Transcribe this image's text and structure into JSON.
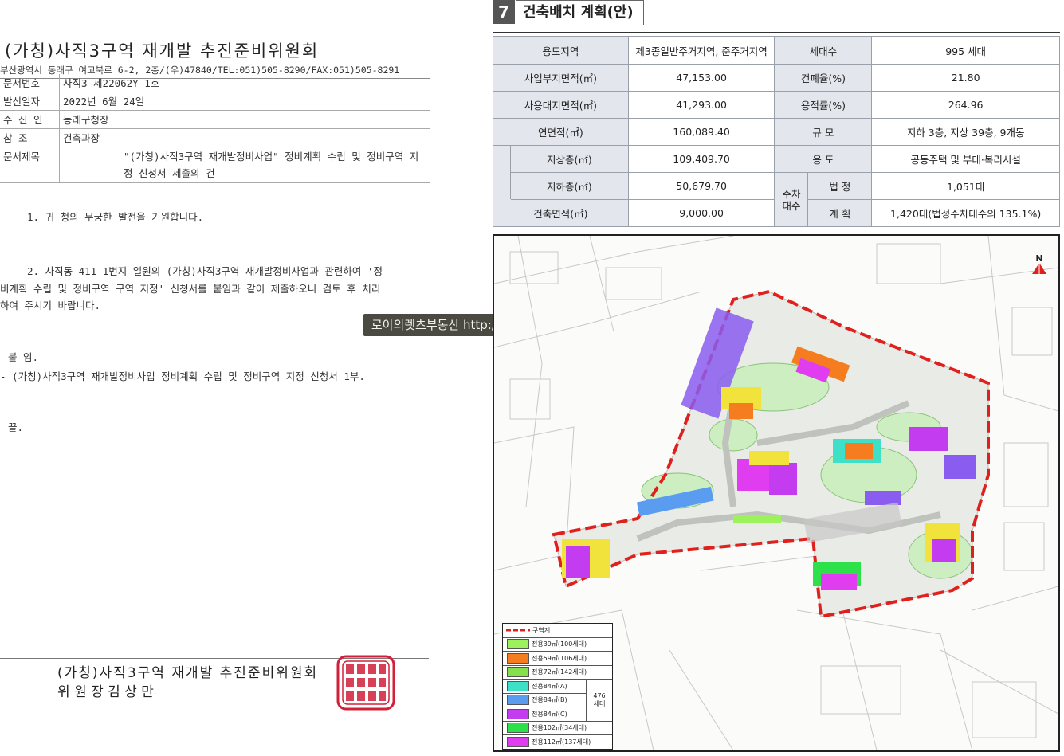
{
  "letter": {
    "org_title": "(가칭)사직3구역 재개발 추진준비위원회",
    "address": "부산광역시 동래구 여고북로 6-2, 2층/(우)47840/TEL:051)505-8290/FAX:051)505-8291",
    "meta": [
      {
        "label": "문서번호",
        "value": "사직3 제22062Y-1호"
      },
      {
        "label": "발신일자",
        "value": "2022년 6월 24일"
      },
      {
        "label": "수 신 인",
        "value": "동래구청장"
      },
      {
        "label": "참    조",
        "value": "건축과장"
      },
      {
        "label": "문서제목",
        "value": "\"(가칭)사직3구역 재개발정비사업\" 정비계획 수립 및 정비구역 지정 신청서 제출의 건"
      }
    ],
    "para1": "1. 귀 청의 무궁한 발전을 기원합니다.",
    "para2_line1": "2. 사직동 411-1번지 일원의 (가칭)사직3구역 재개발정비사업과 관련하여 '정",
    "para2_line2": "비계획 수립 및 정비구역 구역 지정' 신청서를 붙임과 같이 제출하오니 검토 후 처리",
    "para2_line3": "하여 주시기 바랍니다.",
    "attach_label": "붙 임.",
    "attach_item": "- (가칭)사직3구역 재개발정비사업 정비계획 수립 및 정비구역 지정 신청서 1부.",
    "end_mark": "끝.",
    "sign_org": "(가칭)사직3구역 재개발 추진준비위원회",
    "sign_name": "위   원   장   김   상   만",
    "seal_text": "사직3구역재개발추진준비위원회"
  },
  "watermark": "로이의렛츠부동산 http://letsbudongsan.com",
  "section": {
    "number": "7",
    "title": "건축배치 계획(안)"
  },
  "plan_table": {
    "zone_label": "용도지역",
    "zone_value": "제3종일반주거지역, 준주거지역",
    "units_label": "세대수",
    "units_value": "995 세대",
    "site_area_label": "사업부지면적(㎡)",
    "site_area_value": "47,153.00",
    "coverage_label": "건폐율(%)",
    "coverage_value": "21.80",
    "use_site_label": "사용대지면적(㎡)",
    "use_site_value": "41,293.00",
    "far_label": "용적률(%)",
    "far_value": "264.96",
    "gfa_label": "연면적(㎡)",
    "gfa_value": "160,089.40",
    "scale_label": "규 모",
    "scale_value": "지하 3층, 지상 39층, 9개동",
    "above_label": "지상층(㎡)",
    "above_value": "109,409.70",
    "use_label": "용 도",
    "use_value": "공동주택 및 부대·복리시설",
    "below_label": "지하층(㎡)",
    "below_value": "50,679.70",
    "parking_label": "주차\n대수",
    "legal_label": "법 정",
    "legal_value": "1,051대",
    "building_area_label": "건축면적(㎡)",
    "building_area_value": "9,000.00",
    "planned_label": "계 획",
    "planned_value": "1,420대(법정주차대수의 135.1%)"
  },
  "map": {
    "north": "N",
    "legend_title": "구역계",
    "legend": [
      {
        "label": "전용39㎡(100세대)",
        "color": "#9cf25a"
      },
      {
        "label": "전용59㎡(106세대)",
        "color": "#f57c1f"
      },
      {
        "label": "전용72㎡(142세대)",
        "color": "#86e04a"
      },
      {
        "label": "전용84㎡(A)",
        "color": "#3fe0c8"
      },
      {
        "label": "전용84㎡(B)",
        "color": "#5a9cf0"
      },
      {
        "label": "전용84㎡(C)",
        "color": "#c43cf0"
      },
      {
        "label": "전용102㎡(34세대)",
        "color": "#2ee04a"
      },
      {
        "label": "전용112㎡(137세대)",
        "color": "#e03cf0"
      }
    ],
    "legend_group_count": "476\n세대",
    "boundary_color": "#e0201c"
  }
}
